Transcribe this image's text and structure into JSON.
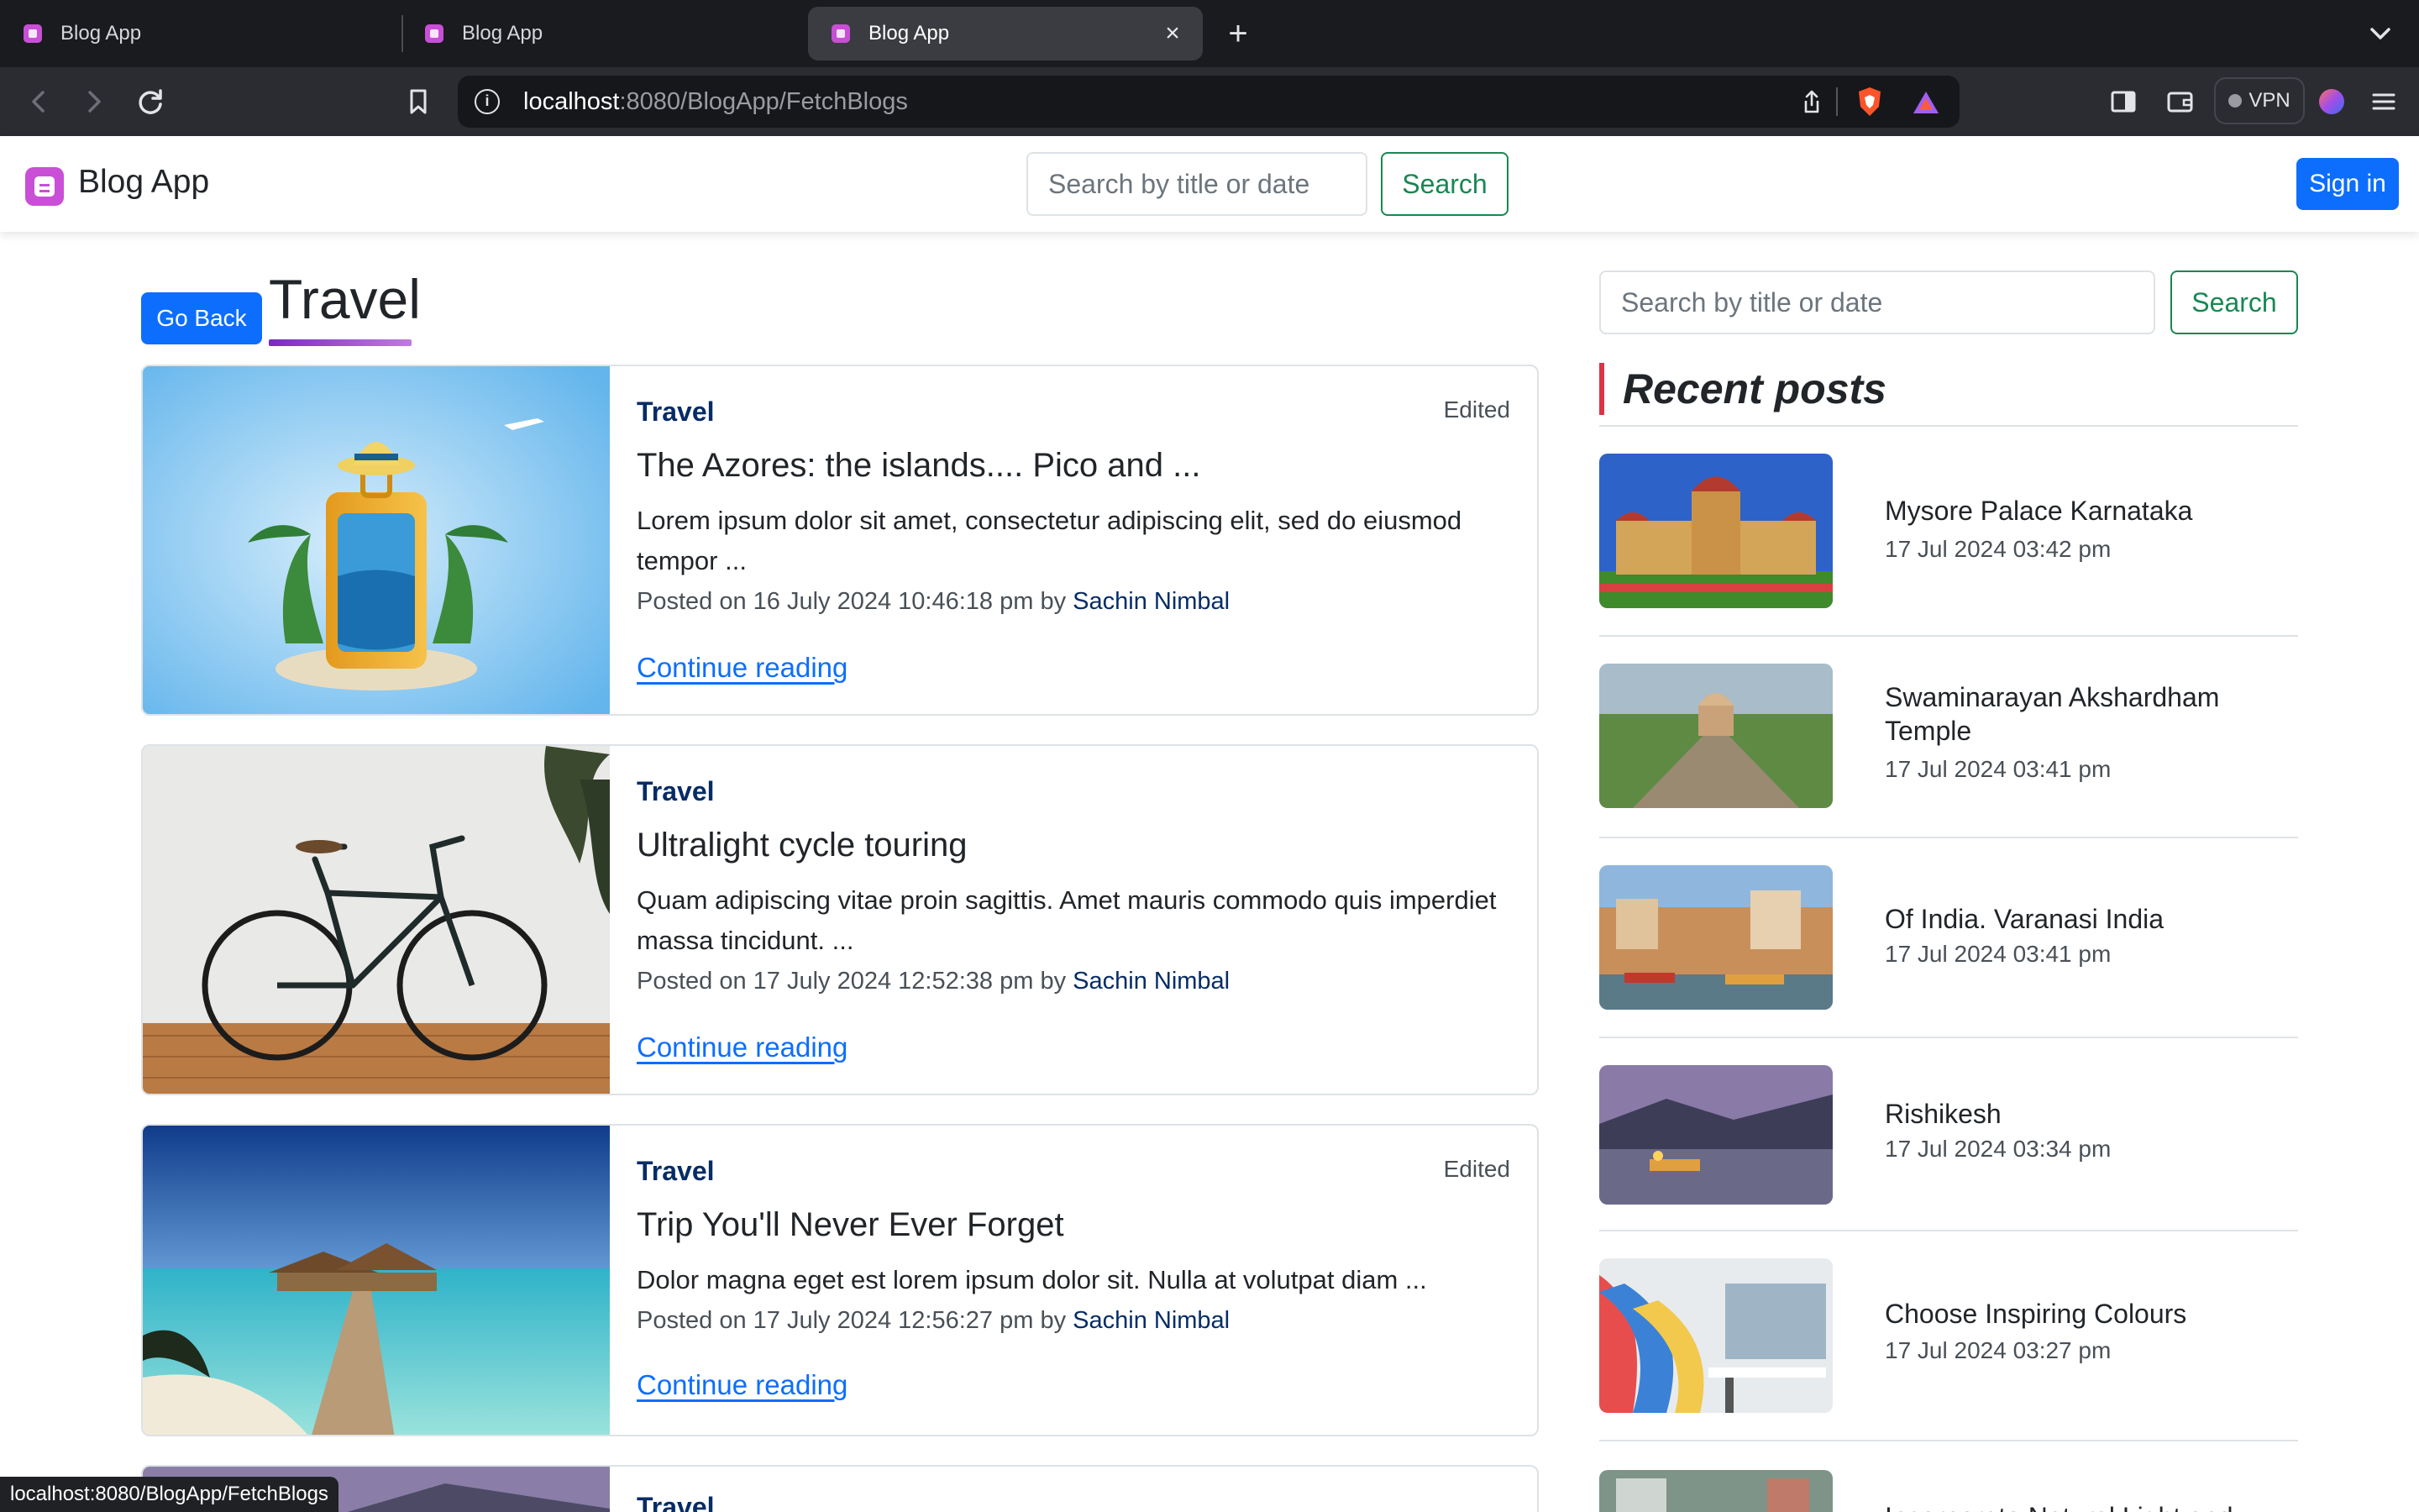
{
  "browser": {
    "tabs": [
      {
        "title": "Blog App"
      },
      {
        "title": "Blog App"
      },
      {
        "title": "Blog App"
      }
    ],
    "new_tab": "+",
    "close_tab": "×",
    "url": {
      "host": "localhost",
      "path": ":8080/BlogApp/FetchBlogs"
    },
    "vpn_label": "VPN",
    "status_url": "localhost:8080/BlogApp/FetchBlogs"
  },
  "navbar": {
    "brand": "Blog App",
    "search_placeholder": "Search by title or date",
    "search_button": "Search",
    "signin_button": "Sign in"
  },
  "page": {
    "go_back": "Go Back",
    "title": "Travel"
  },
  "posts": [
    {
      "category": "Travel",
      "edited": "Edited",
      "title": "The Azores: the islands.... Pico and ...",
      "excerpt": "Lorem ipsum dolor sit amet, consectetur adipiscing elit, sed do eiusmod tempor ...",
      "meta_prefix": "Posted on 16 July 2024 10:46:18 pm by",
      "author": "Sachin Nimbal",
      "link": "Continue reading"
    },
    {
      "category": "Travel",
      "edited": "",
      "title": "Ultralight cycle touring",
      "excerpt": "Quam adipiscing vitae proin sagittis. Amet mauris commodo quis imperdiet massa tincidunt. ...",
      "meta_prefix": "Posted on 17 July 2024 12:52:38 pm by",
      "author": "Sachin Nimbal",
      "link": "Continue reading"
    },
    {
      "category": "Travel",
      "edited": "Edited",
      "title": "Trip You'll Never Ever Forget",
      "excerpt": "Dolor magna eget est lorem ipsum dolor sit. Nulla at volutpat diam ...",
      "meta_prefix": "Posted on 17 July 2024 12:56:27 pm by",
      "author": "Sachin Nimbal",
      "link": "Continue reading"
    },
    {
      "category": "Travel"
    }
  ],
  "sidebar": {
    "search_placeholder": "Search by title or date",
    "search_button": "Search",
    "heading": "Recent posts",
    "recent": [
      {
        "title": "Mysore Palace Karnataka",
        "date": "17 Jul 2024 03:42 pm"
      },
      {
        "title": "Swaminarayan Akshardham Temple",
        "date": "17 Jul 2024 03:41 pm"
      },
      {
        "title": "Of India. Varanasi India",
        "date": "17 Jul 2024 03:41 pm"
      },
      {
        "title": "Rishikesh",
        "date": "17 Jul 2024 03:34 pm"
      },
      {
        "title": "Choose Inspiring Colours",
        "date": "17 Jul 2024 03:27 pm"
      },
      {
        "title": "Incorporate Natural Light and"
      }
    ]
  },
  "colors": {
    "primary": "#0d6efd",
    "success": "#198754",
    "category": "#052c65",
    "accent_bar": "#dc3545",
    "brand": "#c94fd6"
  }
}
